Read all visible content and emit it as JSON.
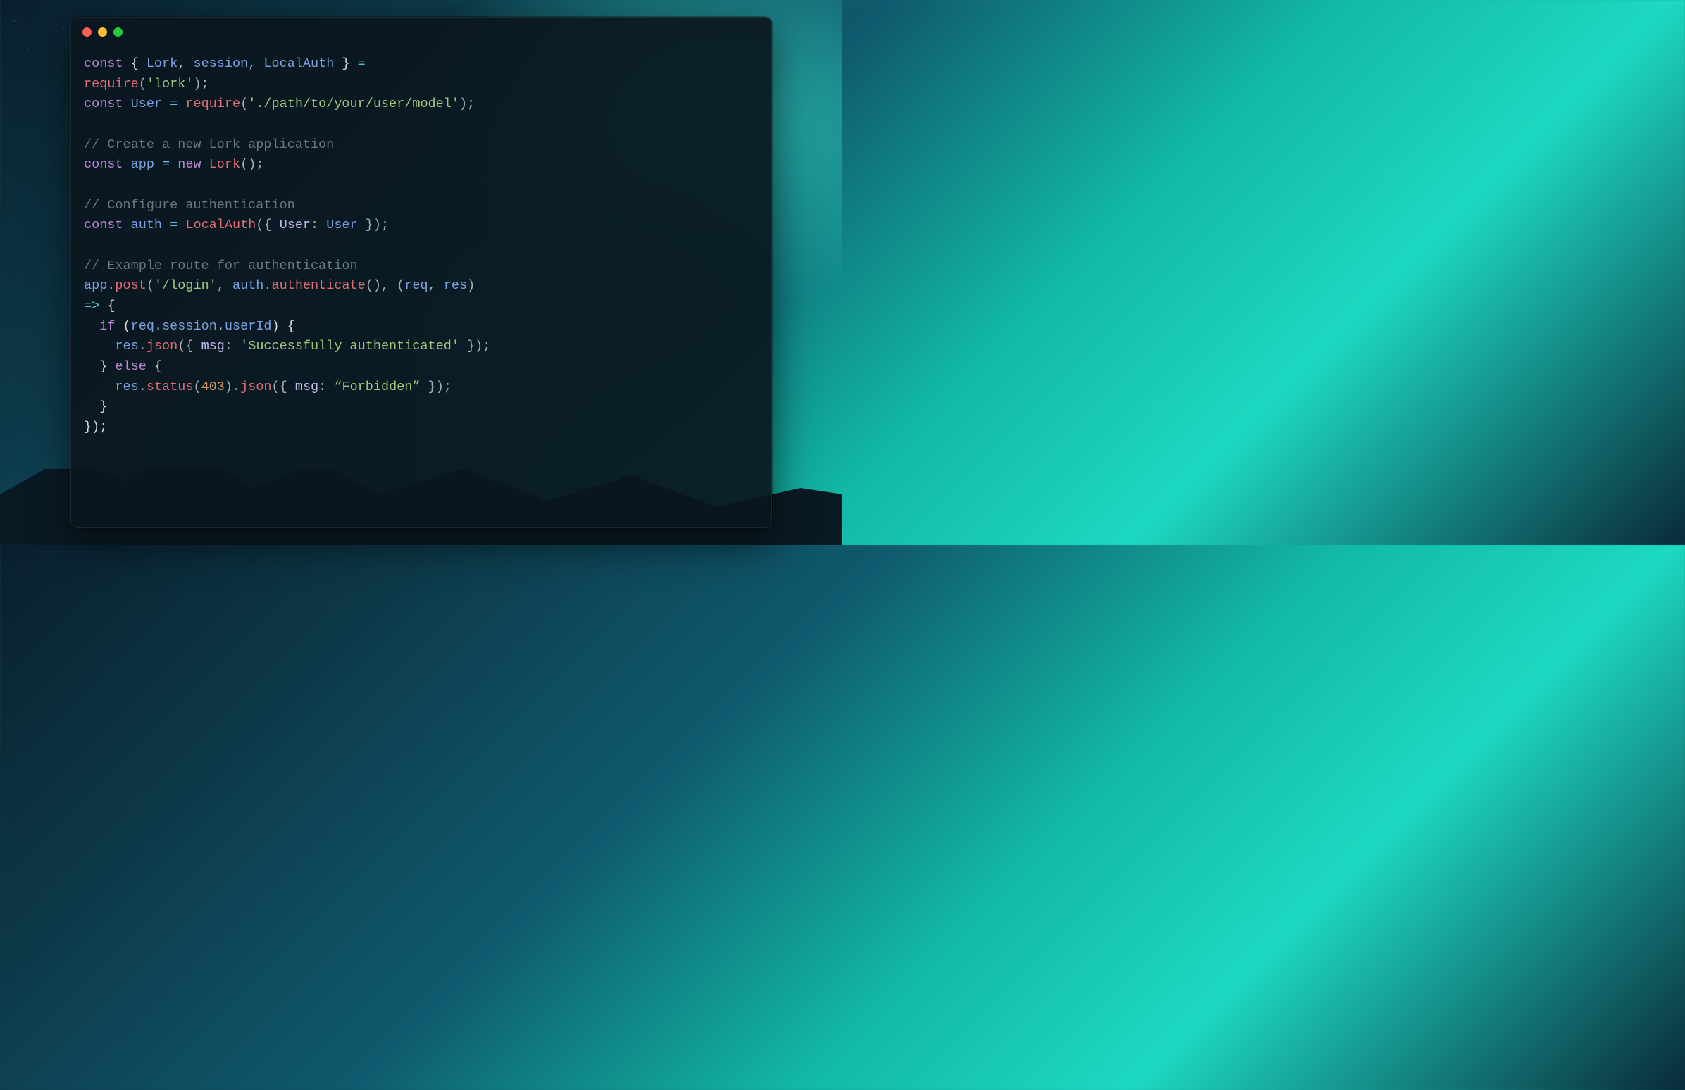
{
  "window": {
    "traffic_lights": {
      "red": "close",
      "yellow": "minimize",
      "green": "zoom"
    }
  },
  "code": {
    "tokens": [
      [
        [
          "kw",
          "const"
        ],
        [
          "white",
          " { "
        ],
        [
          "ident",
          "Lork"
        ],
        [
          "punc",
          ", "
        ],
        [
          "ident",
          "session"
        ],
        [
          "punc",
          ", "
        ],
        [
          "ident",
          "LocalAuth"
        ],
        [
          "white",
          " } "
        ],
        [
          "op",
          "="
        ],
        [
          "white",
          " "
        ]
      ],
      [
        [
          "fn",
          "require"
        ],
        [
          "punc",
          "("
        ],
        [
          "str",
          "'lork'"
        ],
        [
          "punc",
          ");"
        ]
      ],
      [
        [
          "kw",
          "const"
        ],
        [
          "white",
          " "
        ],
        [
          "ident",
          "User"
        ],
        [
          "white",
          " "
        ],
        [
          "op",
          "="
        ],
        [
          "white",
          " "
        ],
        [
          "fn",
          "require"
        ],
        [
          "punc",
          "("
        ],
        [
          "str",
          "'./path/to/your/user/model'"
        ],
        [
          "punc",
          ");"
        ]
      ],
      [],
      [
        [
          "comment",
          "// Create a new Lork application"
        ]
      ],
      [
        [
          "kw",
          "const"
        ],
        [
          "white",
          " "
        ],
        [
          "ident",
          "app"
        ],
        [
          "white",
          " "
        ],
        [
          "op",
          "="
        ],
        [
          "white",
          " "
        ],
        [
          "kw",
          "new"
        ],
        [
          "white",
          " "
        ],
        [
          "fn",
          "Lork"
        ],
        [
          "punc",
          "();"
        ]
      ],
      [],
      [
        [
          "comment",
          "// Configure authentication"
        ]
      ],
      [
        [
          "kw",
          "const"
        ],
        [
          "white",
          " "
        ],
        [
          "ident",
          "auth"
        ],
        [
          "white",
          " "
        ],
        [
          "op",
          "="
        ],
        [
          "white",
          " "
        ],
        [
          "fn",
          "LocalAuth"
        ],
        [
          "punc",
          "({ "
        ],
        [
          "prop",
          "User"
        ],
        [
          "punc",
          ": "
        ],
        [
          "ident",
          "User"
        ],
        [
          "punc",
          " });"
        ]
      ],
      [],
      [
        [
          "comment",
          "// Example route for authentication"
        ]
      ],
      [
        [
          "ident",
          "app"
        ],
        [
          "punc",
          "."
        ],
        [
          "fn",
          "post"
        ],
        [
          "punc",
          "("
        ],
        [
          "str",
          "'/login'"
        ],
        [
          "punc",
          ", "
        ],
        [
          "ident",
          "auth"
        ],
        [
          "punc",
          "."
        ],
        [
          "fn",
          "authenticate"
        ],
        [
          "punc",
          "(), ("
        ],
        [
          "ident",
          "req"
        ],
        [
          "punc",
          ", "
        ],
        [
          "ident",
          "res"
        ],
        [
          "punc",
          ") "
        ]
      ],
      [
        [
          "op",
          "=>"
        ],
        [
          "white",
          " {"
        ]
      ],
      [
        [
          "white",
          "  "
        ],
        [
          "kw",
          "if"
        ],
        [
          "white",
          " ("
        ],
        [
          "ident",
          "req"
        ],
        [
          "punc",
          "."
        ],
        [
          "ident",
          "session"
        ],
        [
          "punc",
          "."
        ],
        [
          "ident",
          "userId"
        ],
        [
          "white",
          ") {"
        ]
      ],
      [
        [
          "white",
          "    "
        ],
        [
          "ident",
          "res"
        ],
        [
          "punc",
          "."
        ],
        [
          "fn",
          "json"
        ],
        [
          "punc",
          "({ "
        ],
        [
          "prop",
          "msg"
        ],
        [
          "punc",
          ": "
        ],
        [
          "str",
          "'Successfully authenticated'"
        ],
        [
          "punc",
          " });"
        ]
      ],
      [
        [
          "white",
          "  } "
        ],
        [
          "kw",
          "else"
        ],
        [
          "white",
          " {"
        ]
      ],
      [
        [
          "white",
          "    "
        ],
        [
          "ident",
          "res"
        ],
        [
          "punc",
          "."
        ],
        [
          "fn",
          "status"
        ],
        [
          "punc",
          "("
        ],
        [
          "num",
          "403"
        ],
        [
          "punc",
          ")."
        ],
        [
          "fn",
          "json"
        ],
        [
          "punc",
          "({ "
        ],
        [
          "prop",
          "msg"
        ],
        [
          "punc",
          ": "
        ],
        [
          "str",
          "“Forbidden”"
        ],
        [
          "punc",
          " });"
        ]
      ],
      [
        [
          "white",
          "  }"
        ]
      ],
      [
        [
          "white",
          "});"
        ]
      ]
    ]
  },
  "colors": {
    "bg_window": "#0a161e",
    "keyword": "#bb86d6",
    "identifier": "#7aa2e0",
    "function": "#e06c75",
    "string": "#a2c77b",
    "number": "#d19a66",
    "comment": "#6b7785",
    "operator": "#56c1d6"
  }
}
